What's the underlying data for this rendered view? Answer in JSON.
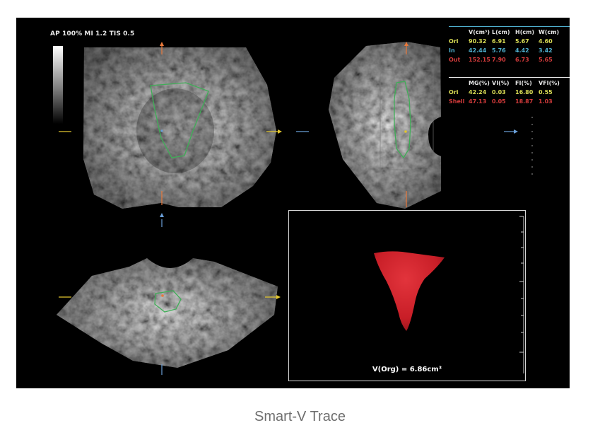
{
  "header": {
    "params": "AP 100%  MI 1.2  TIS 0.5"
  },
  "volume_table": {
    "header": [
      "",
      "V(cm³)",
      "L(cm)",
      "H(cm)",
      "W(cm)"
    ],
    "rows": [
      {
        "label": "Ori",
        "values": [
          "90.32",
          "6.91",
          "5.67",
          "4.60"
        ]
      },
      {
        "label": "In",
        "values": [
          "42.44",
          "5.76",
          "4.42",
          "3.42"
        ]
      },
      {
        "label": "Out",
        "values": [
          "152.15",
          "7.90",
          "6.73",
          "5.65"
        ]
      }
    ]
  },
  "vascular_table": {
    "header": [
      "",
      "MG(%)",
      "VI(%)",
      "FI(%)",
      "VFI(%)"
    ],
    "rows": [
      {
        "label": "Ori",
        "values": [
          "42.24",
          "0.03",
          "16.80",
          "0.55"
        ]
      },
      {
        "label": "Shell",
        "values": [
          "47.13",
          "0.05",
          "18.87",
          "1.03"
        ]
      }
    ]
  },
  "render": {
    "volume_label": "V(Org) = 6.86cm³"
  },
  "caption": "Smart-V Trace",
  "colors": {
    "trace": "#3fae57",
    "render_red": "#c81e27",
    "ori": "#d9dc55",
    "in": "#4fb0cf",
    "out": "#d43b3b",
    "marker_orange": "#e8783a",
    "marker_yellow": "#e2c62f",
    "marker_blue": "#6a9fd8"
  }
}
